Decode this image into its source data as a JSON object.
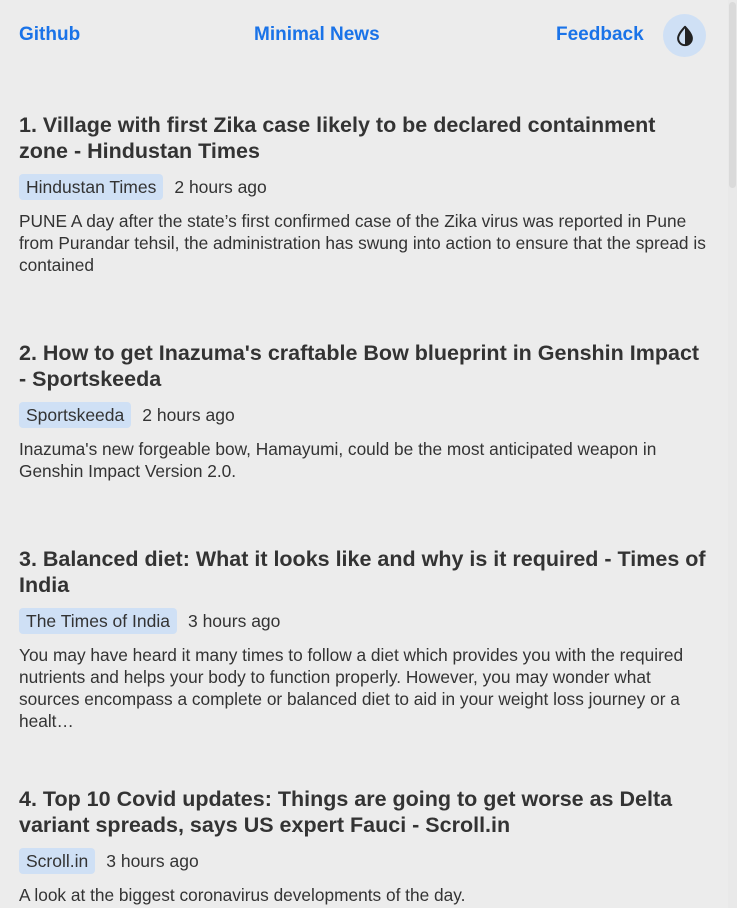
{
  "nav": {
    "github": "Github",
    "brand": "Minimal News",
    "feedback": "Feedback",
    "theme_icon": "contrast-icon"
  },
  "articles": [
    {
      "title": "1. Village with first Zika case likely to be declared containment zone - Hindustan Times",
      "source": "Hindustan Times",
      "time": "2 hours ago",
      "summary": "PUNE A day after the state’s first confirmed case of the Zika virus was reported in Pune from Purandar tehsil, the administration has swung into action to ensure that the spread is contained"
    },
    {
      "title": "2. How to get Inazuma's craftable Bow blueprint in Genshin Impact - Sportskeeda",
      "source": "Sportskeeda",
      "time": "2 hours ago",
      "summary": "Inazuma's new forgeable bow, Hamayumi, could be the most anticipated weapon in Genshin Impact Version 2.0."
    },
    {
      "title": "3. Balanced diet: What it looks like and why is it required - Times of India",
      "source": "The Times of India",
      "time": "3 hours ago",
      "summary": "You may have heard it many times to follow a diet which provides you with the required nutrients and helps your body to function properly. However, you may wonder what sources encompass a complete or balanced diet to aid in your weight loss journey or a healt…"
    },
    {
      "title": "4. Top 10 Covid updates: Things are going to get worse as Delta variant spreads, says US expert Fauci - Scroll.in",
      "source": "Scroll.in",
      "time": "3 hours ago",
      "summary": "A look at the biggest coronavirus developments of the day."
    }
  ],
  "colors": {
    "link": "#1a73e8",
    "badge": "#cfe0f5",
    "background": "#ececec",
    "text": "#333333"
  }
}
